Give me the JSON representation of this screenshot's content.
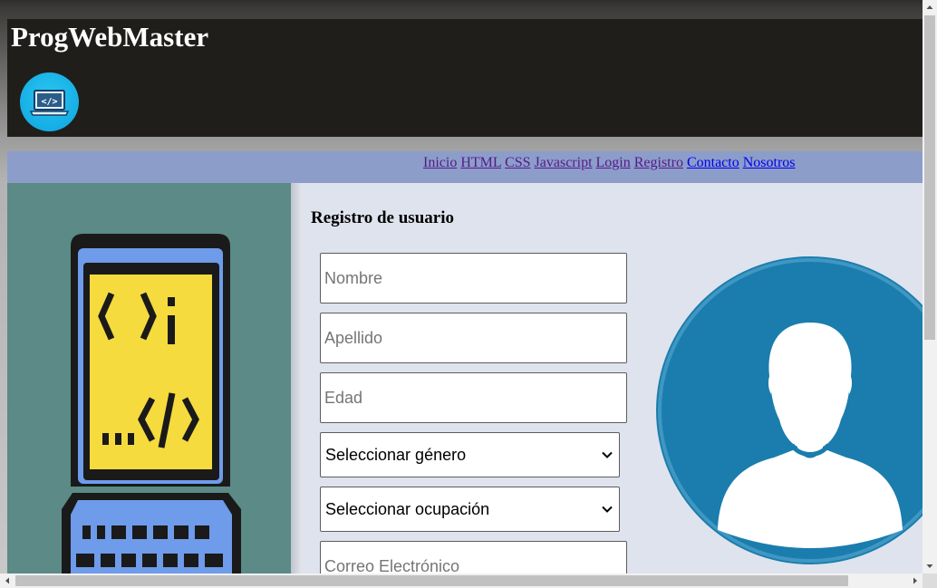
{
  "header": {
    "site_title": "ProgWebMaster",
    "logo_icon": "laptop-code-icon"
  },
  "nav": {
    "links": [
      {
        "label": "Inicio",
        "state": "visited"
      },
      {
        "label": "HTML",
        "state": "visited"
      },
      {
        "label": "CSS",
        "state": "visited"
      },
      {
        "label": "Javascript",
        "state": "visited"
      },
      {
        "label": "Login",
        "state": "visited"
      },
      {
        "label": "Registro",
        "state": "visited"
      },
      {
        "label": "Contacto",
        "state": "unvisited"
      },
      {
        "label": "Nosotros",
        "state": "unvisited"
      }
    ]
  },
  "form": {
    "title": "Registro de usuario",
    "nombre_placeholder": "Nombre",
    "apellido_placeholder": "Apellido",
    "edad_placeholder": "Edad",
    "genero_selected": "Seleccionar género",
    "ocupacion_selected": "Seleccionar ocupación",
    "correo_placeholder": "Correo Electrónico"
  },
  "images": {
    "sidebar": "laptop-code-illustration",
    "avatar": "user-avatar-icon"
  },
  "colors": {
    "header_bg": "#201e1b",
    "nav_bg": "#8c9dc9",
    "sidebar_bg": "#5b8a87",
    "main_bg": "#dfe3ed",
    "avatar_bg": "#1a7dad",
    "link_visited": "#551a8b",
    "link_unvisited": "#0000ee"
  }
}
